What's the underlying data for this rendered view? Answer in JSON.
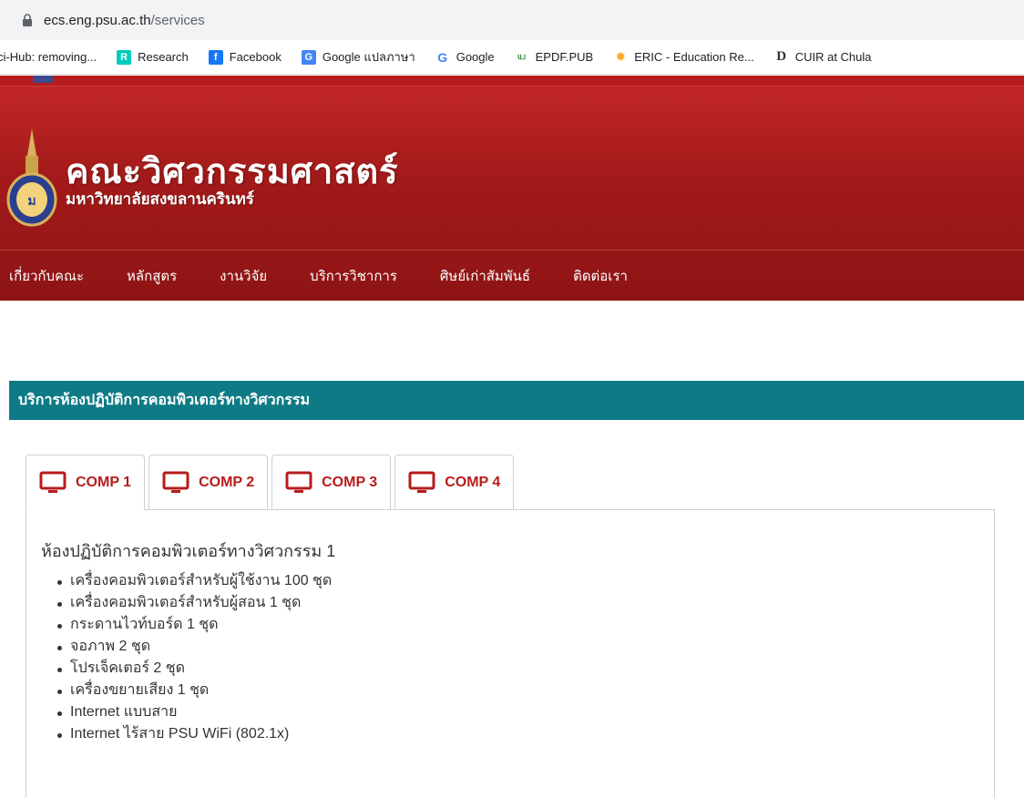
{
  "browser": {
    "url_host": "ecs.eng.psu.ac.th",
    "url_path": "/services",
    "bookmarks": [
      {
        "label": "ci-Hub: removing...",
        "icon": "scihub-icon"
      },
      {
        "label": "Research",
        "icon": "researchgate-icon",
        "icon_text": "R",
        "color": "#00ccbb"
      },
      {
        "label": "Facebook",
        "icon": "facebook-icon",
        "icon_text": "f",
        "color": "#1877f2"
      },
      {
        "label": "Google แปลภาษา",
        "icon": "google-translate-icon",
        "icon_text": "G",
        "color": "#4285f4"
      },
      {
        "label": "Google",
        "icon": "google-icon",
        "icon_text": "G",
        "color": "#4285f4"
      },
      {
        "label": "EPDF.PUB",
        "icon": "epdf-icon",
        "icon_text": "ய",
        "color": "#2e7d32"
      },
      {
        "label": "ERIC - Education Re...",
        "icon": "eric-icon",
        "icon_text": "✹",
        "color": "#f9a825"
      },
      {
        "label": "CUIR at Chula",
        "icon": "cuir-icon",
        "icon_text": "D",
        "color": "#333333"
      }
    ]
  },
  "header": {
    "title": "คณะวิศวกรรมศาสตร์",
    "subtitle": "มหาวิทยาลัยสงขลานครินทร์",
    "colors": {
      "bg_top": "#c62828",
      "bg_bottom": "#8e1414"
    }
  },
  "nav": {
    "items": [
      "เกี่ยวกับคณะ",
      "หลักสูตร",
      "งานวิจัย",
      "บริการวิชาการ",
      "ศิษย์เก่าสัมพันธ์",
      "ติดต่อเรา"
    ]
  },
  "section": {
    "title": "บริการห้องปฏิบัติการคอมพิวเตอร์ทางวิศวกรรม",
    "color": "#0d7a85"
  },
  "tabs": [
    {
      "label": "COMP 1",
      "active": true
    },
    {
      "label": "COMP 2",
      "active": false
    },
    {
      "label": "COMP 3",
      "active": false
    },
    {
      "label": "COMP 4",
      "active": false
    }
  ],
  "panel": {
    "title": "ห้องปฏิบัติการคอมพิวเตอร์ทางวิศวกรรม 1",
    "items": [
      "เครื่องคอมพิวเตอร์สำหรับผู้ใช้งาน 100 ชุด",
      "เครื่องคอมพิวเตอร์สำหรับผู้สอน 1 ชุด",
      "กระดานไวท์บอร์ด 1 ชุด",
      "จอภาพ 2 ชุด",
      "โปรเจ็คเตอร์ 2 ชุด",
      "เครื่องขยายเสียง 1 ชุด",
      "Internet แบบสาย",
      "Internet ไร้สาย PSU WiFi (802.1x)"
    ]
  }
}
